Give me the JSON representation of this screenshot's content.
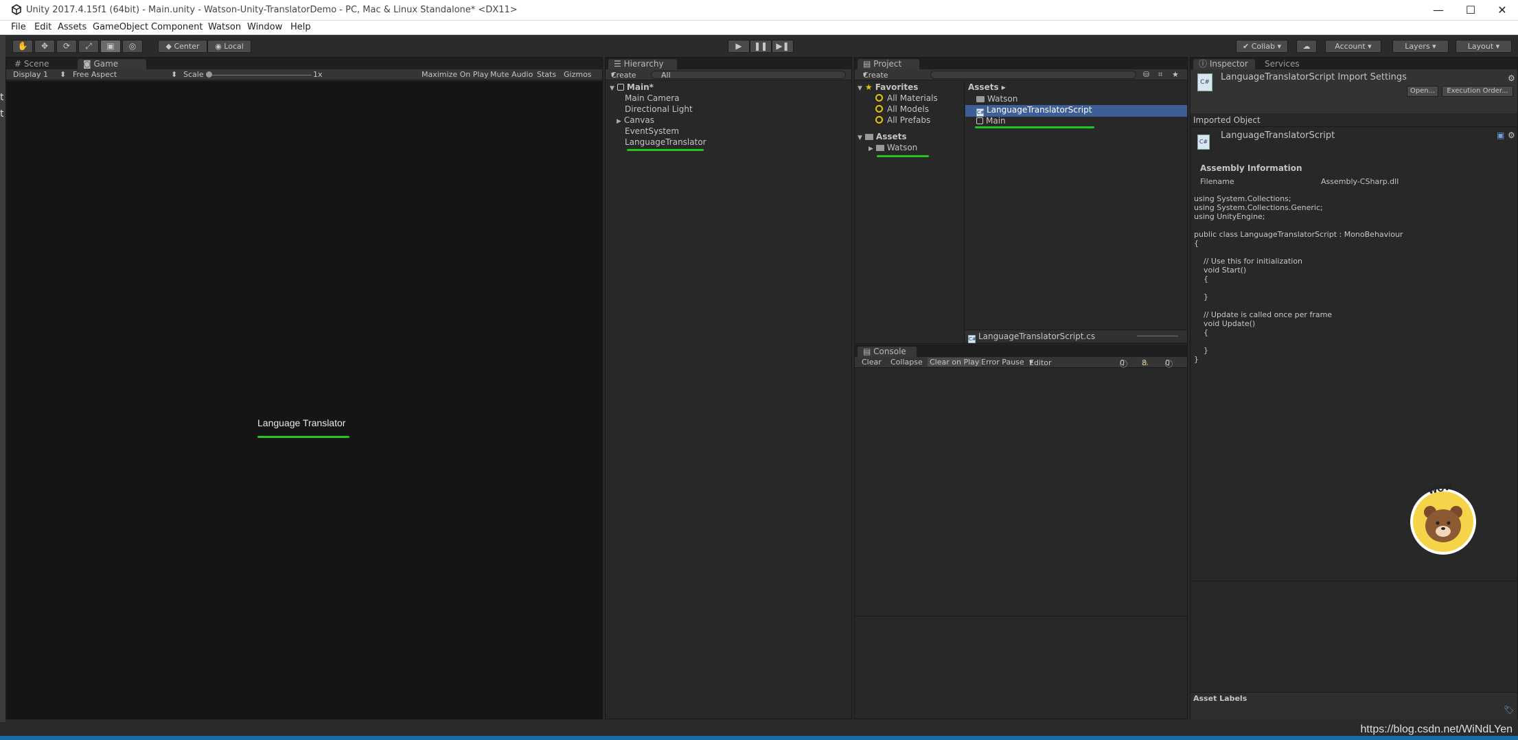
{
  "window": {
    "title": "Unity 2017.4.15f1 (64bit) - Main.unity - Watson-Unity-TranslatorDemo - PC, Mac & Linux Standalone* <DX11>",
    "minimize": "—",
    "maximize": "☐",
    "close": "✕"
  },
  "menu": [
    "File",
    "Edit",
    "Assets",
    "GameObject",
    "Component",
    "Watson",
    "Window",
    "Help"
  ],
  "left_edge_glyphs": [
    "t",
    "t"
  ],
  "toolbar": {
    "pivot": "Center",
    "space": "Local",
    "collab": "Collab",
    "account": "Account",
    "layers": "Layers",
    "layout": "Layout"
  },
  "game_panel": {
    "tabs": [
      "Scene",
      "Game"
    ],
    "display": "Display 1",
    "aspect": "Free Aspect",
    "scale_label": "Scale",
    "scale_value": "1x",
    "options": [
      "Maximize On Play",
      "Mute Audio",
      "Stats",
      "Gizmos"
    ],
    "view_text": "Language Translator"
  },
  "hierarchy": {
    "tab": "Hierarchy",
    "create": "Create",
    "search_placeholder": "All",
    "scene": "Main*",
    "items": [
      "Main Camera",
      "Directional Light",
      "Canvas",
      "EventSystem",
      "LanguageTranslator"
    ]
  },
  "project": {
    "tab": "Project",
    "create": "Create",
    "favorites_label": "Favorites",
    "favorites": [
      "All Materials",
      "All Models",
      "All Prefabs"
    ],
    "assets_label": "Assets",
    "assets_folders": [
      "Watson"
    ],
    "breadcrumb": "Assets",
    "breadcrumb_arrow": "▸",
    "files": [
      "Watson",
      "LanguageTranslatorScript",
      "Main"
    ],
    "selected_file": "LanguageTranslatorScript.cs"
  },
  "console": {
    "tab": "Console",
    "buttons": [
      "Clear",
      "Collapse",
      "Clear on Play",
      "Error Pause",
      "Editor"
    ],
    "counts": {
      "info": "0",
      "warnings": "8",
      "errors": "0"
    }
  },
  "inspector": {
    "tabs": [
      "Inspector",
      "Services"
    ],
    "header": "LanguageTranslatorScript Import Settings",
    "open_button": "Open...",
    "execution_order_button": "Execution Order...",
    "imported_object_label": "Imported Object",
    "object_name": "LanguageTranslatorScript",
    "assembly_info_label": "Assembly Information",
    "filename_label": "Filename",
    "filename_value": "Assembly-CSharp.dll",
    "code": "using System.Collections;\nusing System.Collections.Generic;\nusing UnityEngine;\n\npublic class LanguageTranslatorScript : MonoBehaviour\n{\n\n    // Use this for initialization\n    void Start()\n    {\n\n    }\n\n    // Update is called once per frame\n    void Update()\n    {\n\n    }\n}",
    "asset_labels": "Asset Labels",
    "sticker_text": "WOW~"
  },
  "watermark": "https://blog.csdn.net/WiNdLYen",
  "colors": {
    "selection": "#3e5f96",
    "annotation_green": "#1ec81e",
    "panel_bg": "#282828"
  }
}
